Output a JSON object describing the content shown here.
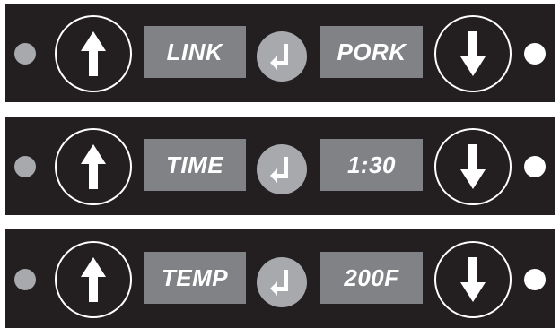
{
  "colors": {
    "panel_background": "#231f20",
    "display_background": "#808285",
    "display_text": "#ffffff",
    "enter_button": "#a7a9ac",
    "left_indicator": "#a7a9ac",
    "right_indicator": "#ffffff",
    "arrow": "#ffffff"
  },
  "icons": {
    "up": "up-arrow-icon",
    "down": "down-arrow-icon",
    "enter": "enter-return-icon"
  },
  "panels": [
    {
      "label": "LINK",
      "value": "PORK"
    },
    {
      "label": "TIME",
      "value": "1:30"
    },
    {
      "label": "TEMP",
      "value": "200F"
    }
  ]
}
